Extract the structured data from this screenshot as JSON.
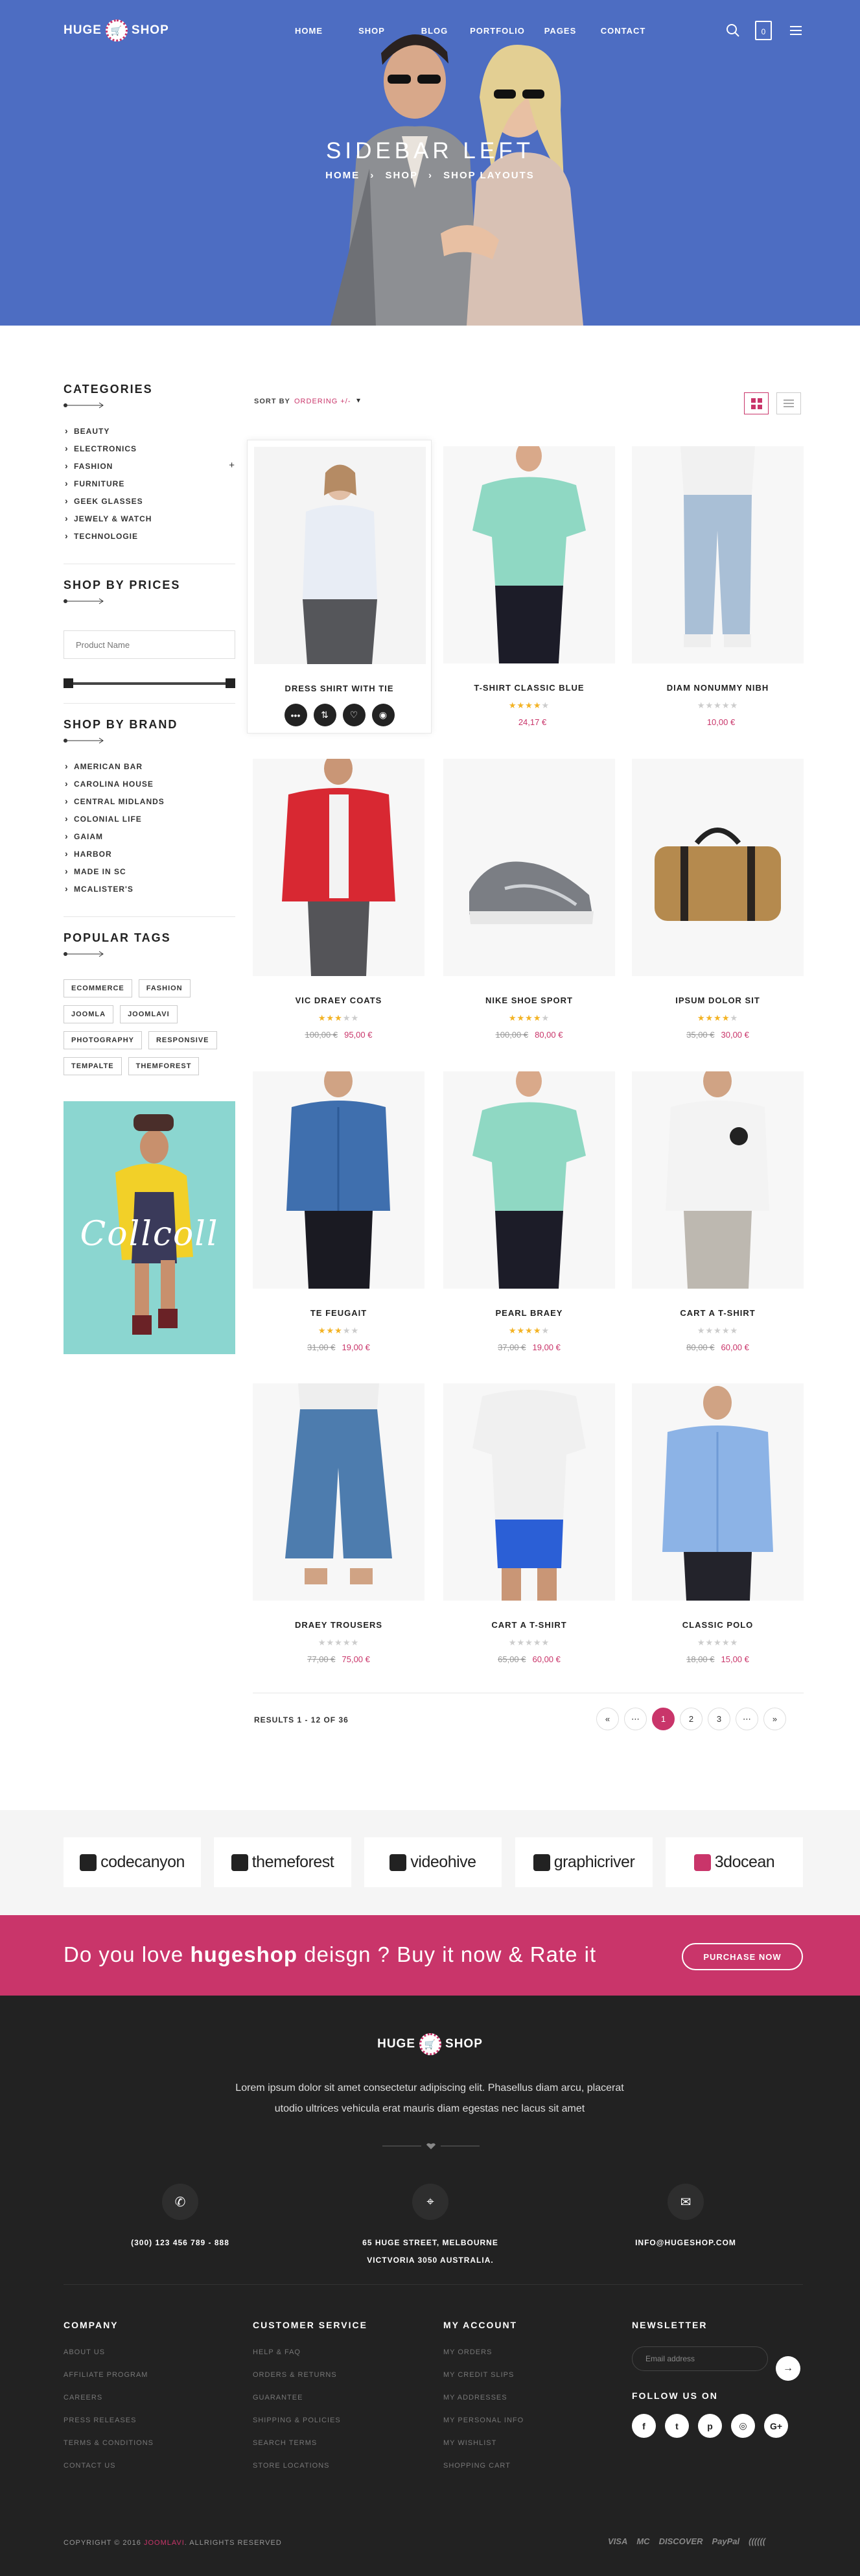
{
  "header": {
    "logo_left": "HUGE",
    "logo_right": "SHOP",
    "nav": [
      "HOME",
      "SHOP",
      "BLOG",
      "PORTFOLIO",
      "PAGES",
      "CONTACT"
    ],
    "cart_count": "0"
  },
  "hero": {
    "title": "SIDEBAR LEFT",
    "breadcrumb": [
      "HOME",
      "SHOP",
      "SHOP LAYOUTS"
    ]
  },
  "sidebar": {
    "categories_title": "CATEGORIES",
    "categories": [
      "BEAUTY",
      "ELECTRONICS",
      "FASHION",
      "FURNITURE",
      "GEEK GLASSES",
      "JEWELY & WATCH",
      "TECHNOLOGIE"
    ],
    "prices_title": "SHOP BY PRICES",
    "name_placeholder": "Product Name",
    "brand_title": "SHOP BY BRAND",
    "brands": [
      "AMERICAN BAR",
      "CAROLINA HOUSE",
      "CENTRAL MIDLANDS",
      "COLONIAL LIFE",
      "GAIAM",
      "HARBOR",
      "MADE IN SC",
      "MCALISTER'S"
    ],
    "tags_title": "POPULAR TAGS",
    "tags": [
      "ECOMMERCE",
      "FASHION",
      "JOOMLA",
      "JOOMLAVI",
      "PHOTOGRAPHY",
      "RESPONSIVE",
      "TEMPALTE",
      "THEMFOREST"
    ],
    "promo_word": "Collcoll"
  },
  "sort": {
    "label": "SORT BY",
    "value": "ORDERING +/-"
  },
  "products": [
    {
      "name": "DRESS SHIRT WITH TIE",
      "rating": 0,
      "old_price": "",
      "price": ""
    },
    {
      "name": "T-SHIRT CLASSIC BLUE",
      "rating": 4,
      "old_price": "",
      "price": "24,17 €"
    },
    {
      "name": "DIAM NONUMMY NIBH",
      "rating": 0,
      "old_price": "",
      "price": "10,00 €"
    },
    {
      "name": "VIC DRAEY COATS",
      "rating": 3,
      "old_price": "100,00 €",
      "price": "95,00 €"
    },
    {
      "name": "NIKE SHOE SPORT",
      "rating": 4,
      "old_price": "100,00 €",
      "price": "80,00 €"
    },
    {
      "name": "IPSUM DOLOR SIT",
      "rating": 4,
      "old_price": "35,00 €",
      "price": "30,00 €"
    },
    {
      "name": "TE FEUGAIT",
      "rating": 3,
      "old_price": "31,00 €",
      "price": "19,00 €"
    },
    {
      "name": "PEARL BRAEY",
      "rating": 4,
      "old_price": "37,00 €",
      "price": "19,00 €"
    },
    {
      "name": "CART A T-SHIRT",
      "rating": 0,
      "old_price": "80,00 €",
      "price": "60,00 €"
    },
    {
      "name": "DRAEY TROUSERS",
      "rating": 0,
      "old_price": "77,00 €",
      "price": "75,00 €"
    },
    {
      "name": "CART A T-SHIRT",
      "rating": 0,
      "old_price": "65,00 €",
      "price": "60,00 €"
    },
    {
      "name": "CLASSIC POLO",
      "rating": 0,
      "old_price": "18,00 €",
      "price": "15,00 €"
    }
  ],
  "results": "RESULTS 1 - 12 OF 36",
  "pagination": [
    "«",
    "⋯",
    "1",
    "2",
    "3",
    "⋯",
    "»"
  ],
  "brands": [
    "codecanyon",
    "themeforest",
    "videohive",
    "graphicriver",
    "3docean"
  ],
  "cta": {
    "text_before": "Do you love ",
    "text_bold": "hugeshop",
    "text_after": " deisgn ? Buy it now & Rate it",
    "button": "PURCHASE NOW"
  },
  "footer": {
    "about": "Lorem ipsum dolor sit amet consectetur adipiscing elit. Phasellus diam arcu, placerat utodio ultrices vehicula erat mauris diam egestas nec lacus sit amet",
    "phone": "(300) 123 456 789 - 888",
    "address": "65 HUGE STREET, MELBOURNE VICTVORIA 3050 AUSTRALIA.",
    "email": "INFO@HUGESHOP.COM",
    "company_title": "COMPANY",
    "company": [
      "ABOUT US",
      "AFFILIATE PROGRAM",
      "CAREERS",
      "PRESS RELEASES",
      "TERMS & CONDITIONS",
      "CONTACT US"
    ],
    "service_title": "CUSTOMER SERVICE",
    "service": [
      "HELP & FAQ",
      "ORDERS & RETURNS",
      "GUARANTEE",
      "SHIPPING & POLICIES",
      "SEARCH TERMS",
      "STORE LOCATIONS"
    ],
    "account_title": "MY ACCOUNT",
    "account": [
      "MY ORDERS",
      "MY CREDIT SLIPS",
      "MY ADDRESSES",
      "MY PERSONAL INFO",
      "MY WISHLIST",
      "SHOPPING CART"
    ],
    "newsletter_title": "NEWSLETTER",
    "newsletter_placeholder": "Email address",
    "follow_title": "FOLLOW US ON",
    "copyright_before": "COPYRIGHT © 2016 ",
    "copyright_hl": "JOOMLAVI",
    "copyright_after": ". ALLRIGHTS RESERVED",
    "payments": [
      "VISA",
      "MC",
      "DISCOVER",
      "PayPal",
      "(((((("
    ]
  },
  "colors": {
    "accent": "#c9356a",
    "hero_bg": "#4d6dc2",
    "footer_bg": "#222222",
    "star": "#f3b324"
  }
}
